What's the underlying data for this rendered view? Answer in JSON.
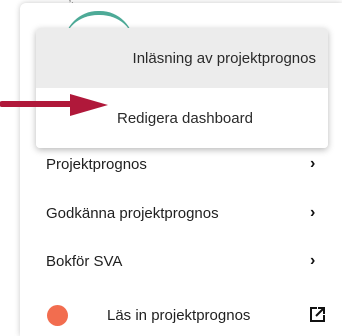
{
  "top_mark": "ʼˑ",
  "submenu": {
    "items": [
      {
        "label": "Inläsning av projektprognos"
      },
      {
        "label": "Redigera dashboard"
      }
    ]
  },
  "menu": {
    "items": [
      {
        "label": "Projektprognos",
        "icon": "chevron-right-icon"
      },
      {
        "label": "Godkänna projektprognos",
        "icon": "chevron-right-icon"
      },
      {
        "label": "Bokför SVA",
        "icon": "chevron-right-icon"
      }
    ],
    "bottom_item": {
      "label": "Läs in projektprognos",
      "dot_color": "#f26d4f",
      "icon": "external-link-icon"
    }
  },
  "colors": {
    "arrow": "#b0183a",
    "submenu_highlight": "#ececec",
    "accent_teal": "#2e9c86"
  },
  "glyphs": {
    "chevron": "›"
  }
}
